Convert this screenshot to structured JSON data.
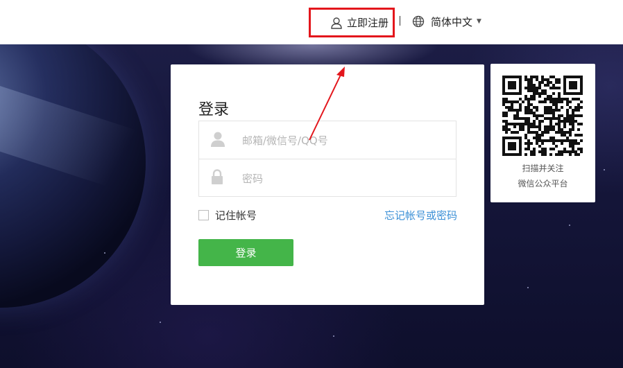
{
  "header": {
    "register_label": "立即注册",
    "language_label": "简体中文",
    "icons": {
      "register": "user-icon",
      "language": "globe-icon",
      "caret": "caret-down-icon"
    }
  },
  "login": {
    "title": "登录",
    "account_placeholder": "邮箱/微信号/QQ号",
    "password_placeholder": "密码",
    "remember_label": "记住帐号",
    "forgot_label": "忘记帐号或密码",
    "submit_label": "登录"
  },
  "qr": {
    "line1": "扫描并关注",
    "line2": "微信公众平台"
  },
  "colors": {
    "accent_green": "#44b549",
    "link_blue": "#3a8fd6",
    "highlight_red": "#e3161c"
  }
}
